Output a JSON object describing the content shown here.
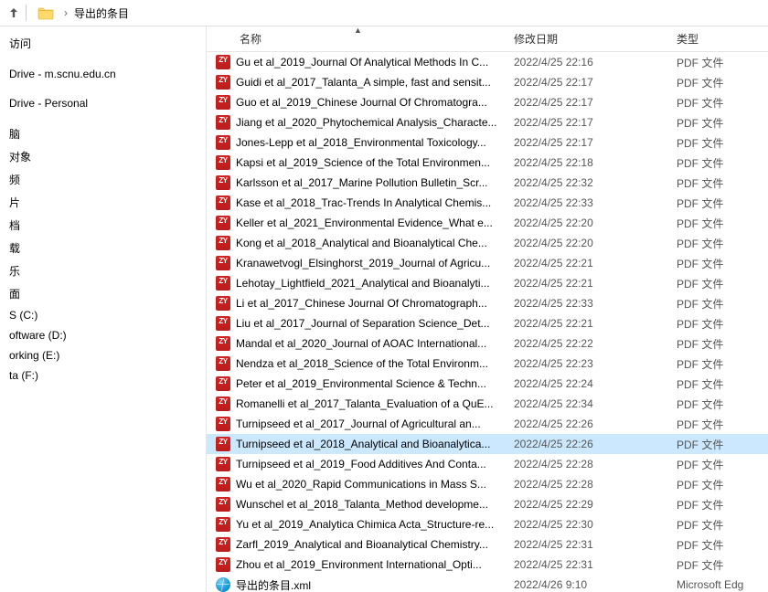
{
  "addressbar": {
    "folder_name": "导出的条目"
  },
  "headers": {
    "name": "名称",
    "date": "修改日期",
    "type": "类型"
  },
  "sidebar": {
    "items": [
      "访问",
      "Drive - m.scnu.edu.cn",
      "Drive - Personal",
      "脑",
      "对象",
      "频",
      "片",
      "档",
      "载",
      "乐",
      "面",
      "S (C:)",
      "oftware (D:)",
      "orking (E:)",
      "ta (F:)"
    ]
  },
  "types": {
    "pdf": "PDF 文件",
    "xml": "Microsoft Edg"
  },
  "selected_index": 19,
  "files": [
    {
      "icon": "pdf",
      "name": "Gu et al_2019_Journal Of Analytical Methods In C...",
      "date": "2022/4/25 22:16",
      "type": "pdf"
    },
    {
      "icon": "pdf",
      "name": "Guidi et al_2017_Talanta_A simple, fast and sensit...",
      "date": "2022/4/25 22:17",
      "type": "pdf"
    },
    {
      "icon": "pdf",
      "name": "Guo et al_2019_Chinese Journal Of Chromatogra...",
      "date": "2022/4/25 22:17",
      "type": "pdf"
    },
    {
      "icon": "pdf",
      "name": "Jiang et al_2020_Phytochemical Analysis_Characte...",
      "date": "2022/4/25 22:17",
      "type": "pdf"
    },
    {
      "icon": "pdf",
      "name": "Jones-Lepp et al_2018_Environmental Toxicology...",
      "date": "2022/4/25 22:17",
      "type": "pdf"
    },
    {
      "icon": "pdf",
      "name": "Kapsi et al_2019_Science of the Total Environmen...",
      "date": "2022/4/25 22:18",
      "type": "pdf"
    },
    {
      "icon": "pdf",
      "name": "Karlsson et al_2017_Marine Pollution Bulletin_Scr...",
      "date": "2022/4/25 22:32",
      "type": "pdf"
    },
    {
      "icon": "pdf",
      "name": "Kase et al_2018_Trac-Trends In Analytical Chemis...",
      "date": "2022/4/25 22:33",
      "type": "pdf"
    },
    {
      "icon": "pdf",
      "name": "Keller et al_2021_Environmental Evidence_What e...",
      "date": "2022/4/25 22:20",
      "type": "pdf"
    },
    {
      "icon": "pdf",
      "name": "Kong et al_2018_Analytical and Bioanalytical Che...",
      "date": "2022/4/25 22:20",
      "type": "pdf"
    },
    {
      "icon": "pdf",
      "name": "Kranawetvogl_Elsinghorst_2019_Journal of Agricu...",
      "date": "2022/4/25 22:21",
      "type": "pdf"
    },
    {
      "icon": "pdf",
      "name": "Lehotay_Lightfield_2021_Analytical and Bioanalyti...",
      "date": "2022/4/25 22:21",
      "type": "pdf"
    },
    {
      "icon": "pdf",
      "name": "Li et al_2017_Chinese Journal Of Chromatograph...",
      "date": "2022/4/25 22:33",
      "type": "pdf"
    },
    {
      "icon": "pdf",
      "name": "Liu et al_2017_Journal of Separation Science_Det...",
      "date": "2022/4/25 22:21",
      "type": "pdf"
    },
    {
      "icon": "pdf",
      "name": "Mandal et al_2020_Journal of AOAC International...",
      "date": "2022/4/25 22:22",
      "type": "pdf"
    },
    {
      "icon": "pdf",
      "name": "Nendza et al_2018_Science of the Total Environm...",
      "date": "2022/4/25 22:23",
      "type": "pdf"
    },
    {
      "icon": "pdf",
      "name": "Peter et al_2019_Environmental Science & Techn...",
      "date": "2022/4/25 22:24",
      "type": "pdf"
    },
    {
      "icon": "pdf",
      "name": "Romanelli et al_2017_Talanta_Evaluation of a QuE...",
      "date": "2022/4/25 22:34",
      "type": "pdf"
    },
    {
      "icon": "pdf",
      "name": "Turnipseed et al_2017_Journal of Agricultural an...",
      "date": "2022/4/25 22:26",
      "type": "pdf"
    },
    {
      "icon": "pdf",
      "name": "Turnipseed et al_2018_Analytical and Bioanalytica...",
      "date": "2022/4/25 22:26",
      "type": "pdf"
    },
    {
      "icon": "pdf",
      "name": "Turnipseed et al_2019_Food Additives And Conta...",
      "date": "2022/4/25 22:28",
      "type": "pdf"
    },
    {
      "icon": "pdf",
      "name": "Wu et al_2020_Rapid Communications in Mass S...",
      "date": "2022/4/25 22:28",
      "type": "pdf"
    },
    {
      "icon": "pdf",
      "name": "Wunschel et al_2018_Talanta_Method developme...",
      "date": "2022/4/25 22:29",
      "type": "pdf"
    },
    {
      "icon": "pdf",
      "name": "Yu et al_2019_Analytica Chimica Acta_Structure-re...",
      "date": "2022/4/25 22:30",
      "type": "pdf"
    },
    {
      "icon": "pdf",
      "name": "Zarfl_2019_Analytical and Bioanalytical Chemistry...",
      "date": "2022/4/25 22:31",
      "type": "pdf"
    },
    {
      "icon": "pdf",
      "name": "Zhou et al_2019_Environment International_Opti...",
      "date": "2022/4/25 22:31",
      "type": "pdf"
    },
    {
      "icon": "xml",
      "name": "导出的条目.xml",
      "date": "2022/4/26 9:10",
      "type": "xml"
    }
  ]
}
